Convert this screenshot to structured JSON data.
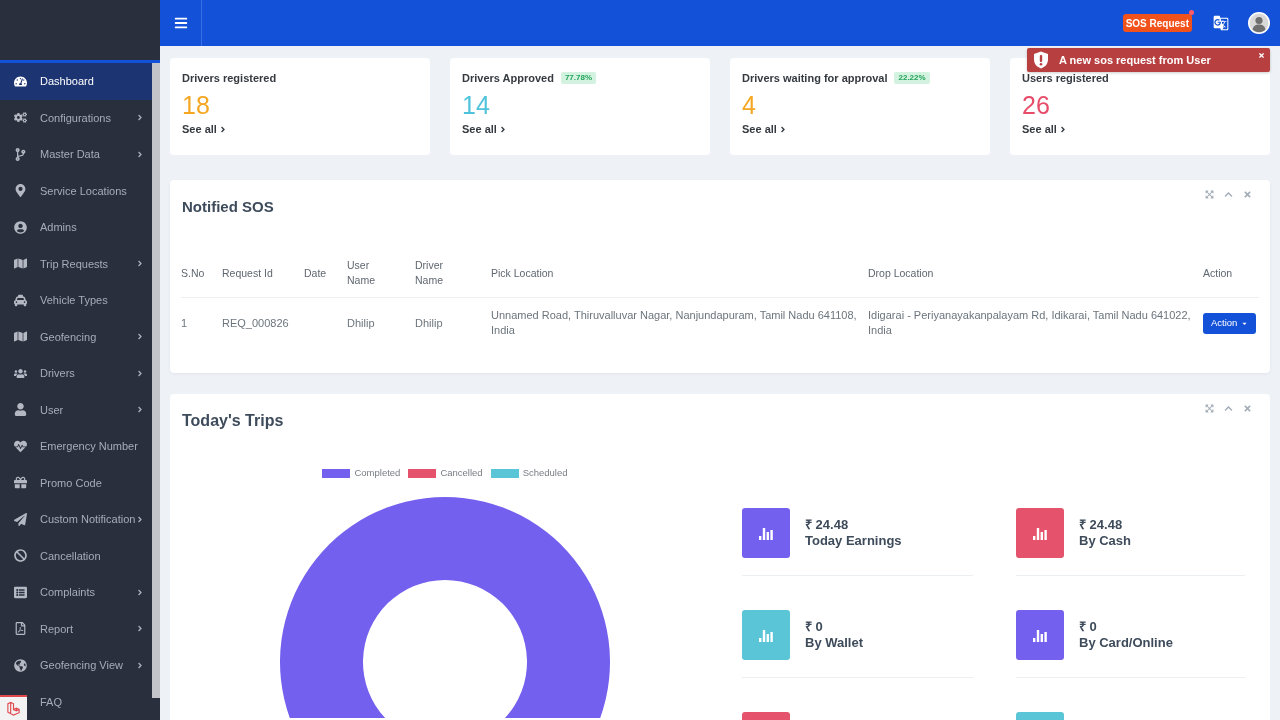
{
  "sidebar": {
    "items": [
      {
        "label": "Dashboard",
        "selected": true,
        "submenu": false
      },
      {
        "label": "Configurations",
        "selected": false,
        "submenu": true
      },
      {
        "label": "Master Data",
        "selected": false,
        "submenu": true
      },
      {
        "label": "Service Locations",
        "selected": false,
        "submenu": false
      },
      {
        "label": "Admins",
        "selected": false,
        "submenu": false
      },
      {
        "label": "Trip Requests",
        "selected": false,
        "submenu": true
      },
      {
        "label": "Vehicle Types",
        "selected": false,
        "submenu": false
      },
      {
        "label": "Geofencing",
        "selected": false,
        "submenu": true
      },
      {
        "label": "Drivers",
        "selected": false,
        "submenu": true
      },
      {
        "label": "User",
        "selected": false,
        "submenu": true
      },
      {
        "label": "Emergency Number",
        "selected": false,
        "submenu": false
      },
      {
        "label": "Promo Code",
        "selected": false,
        "submenu": false
      },
      {
        "label": "Custom Notification",
        "selected": false,
        "submenu": true
      },
      {
        "label": "Cancellation",
        "selected": false,
        "submenu": false
      },
      {
        "label": "Complaints",
        "selected": false,
        "submenu": true
      },
      {
        "label": "Report",
        "selected": false,
        "submenu": true
      },
      {
        "label": "Geofencing View",
        "selected": false,
        "submenu": true
      },
      {
        "label": "FAQ",
        "selected": false,
        "submenu": false
      }
    ]
  },
  "topbar": {
    "sos_button": {
      "label": "SOS Request",
      "new": true
    }
  },
  "toast": {
    "message": "A new sos request from User"
  },
  "stat_cards": [
    {
      "title": "Drivers registered",
      "value": "18",
      "color": "#f5a623",
      "link": "See all"
    },
    {
      "title": "Drivers Approved",
      "badge": "77.78%",
      "value": "14",
      "color": "#4fc3dc",
      "link": "See all"
    },
    {
      "title": "Drivers waiting for approval",
      "badge": "22.22%",
      "value": "4",
      "color": "#f5a623",
      "link": "See all"
    },
    {
      "title": "Users registered",
      "value": "26",
      "color": "#e74c69",
      "link": "See all"
    }
  ],
  "sos_panel": {
    "title": "Notified SOS",
    "columns": [
      "S.No",
      "Request Id",
      "Date",
      "User Name",
      "Driver Name",
      "Pick Location",
      "Drop Location",
      "Action"
    ],
    "rows": [
      {
        "s_no": "1",
        "request_id": "REQ_000826",
        "user_name": "Dhilip",
        "driver_name": "Dhilip",
        "pick_location": "Unnamed Road, Thiruvalluvar Nagar, Nanjundapuram, Tamil Nadu 641108, India",
        "drop_location": "Idigarai - Periyanayakanpalayam Rd, Idikarai, Tamil Nadu 641022, India",
        "action": "Action"
      }
    ]
  },
  "trips_panel": {
    "title": "Today's Trips",
    "legend": [
      {
        "label": "Completed",
        "color": "#7460ee"
      },
      {
        "label": "Cancelled",
        "color": "#e4526b"
      },
      {
        "label": "Scheduled",
        "color": "#5bc5d8"
      }
    ],
    "stats": [
      {
        "amount": "₹ 24.48",
        "label": "Today Earnings",
        "color": "#7460ee"
      },
      {
        "amount": "₹ 24.48",
        "label": "By Cash",
        "color": "#e4526b"
      },
      {
        "amount": "₹ 0",
        "label": "By Wallet",
        "color": "#5bc5d8"
      },
      {
        "amount": "₹ 0",
        "label": "By Card/Online",
        "color": "#7460ee"
      },
      {
        "color": "#e4526b"
      },
      {
        "color": "#5bc5d8"
      }
    ]
  }
}
